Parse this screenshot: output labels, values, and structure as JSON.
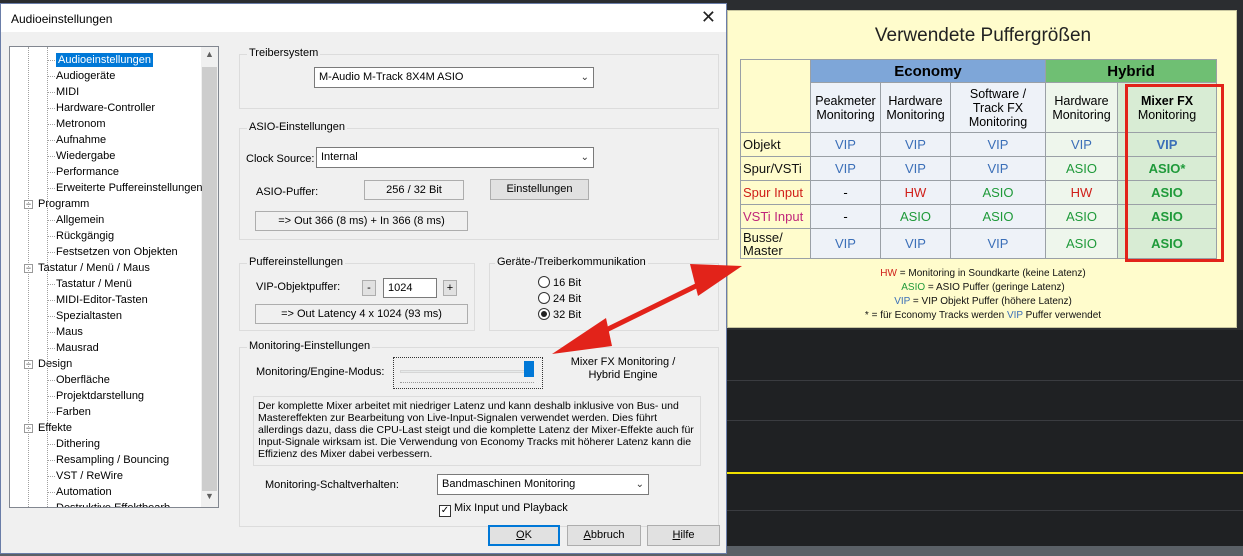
{
  "dialog": {
    "title": "Audioeinstellungen",
    "close_label": "✕"
  },
  "tree": {
    "items": [
      {
        "label": "Audioeinstellungen",
        "selected": true
      },
      {
        "label": "Audiogeräte"
      },
      {
        "label": "MIDI"
      },
      {
        "label": "Hardware-Controller"
      },
      {
        "label": "Metronom"
      },
      {
        "label": "Aufnahme"
      },
      {
        "label": "Wiedergabe"
      },
      {
        "label": "Performance"
      },
      {
        "label": "Erweiterte Puffereinstellungen"
      },
      {
        "label": "Programm",
        "group": true
      },
      {
        "label": "Allgemein"
      },
      {
        "label": "Rückgängig"
      },
      {
        "label": "Festsetzen von Objekten"
      },
      {
        "label": "Tastatur / Menü / Maus",
        "group": true
      },
      {
        "label": "Tastatur / Menü"
      },
      {
        "label": "MIDI-Editor-Tasten"
      },
      {
        "label": "Spezialtasten"
      },
      {
        "label": "Maus"
      },
      {
        "label": "Mausrad"
      },
      {
        "label": "Design",
        "group": true
      },
      {
        "label": "Oberfläche"
      },
      {
        "label": "Projektdarstellung"
      },
      {
        "label": "Farben"
      },
      {
        "label": "Effekte",
        "group": true
      },
      {
        "label": "Dithering"
      },
      {
        "label": "Resampling / Bouncing"
      },
      {
        "label": "VST / ReWire"
      },
      {
        "label": "Automation"
      },
      {
        "label": "Destruktive Effektbearb"
      }
    ]
  },
  "treiber": {
    "group_label": "Treibersystem",
    "value": "M-Audio M-Track 8X4M ASIO"
  },
  "asio": {
    "group_label": "ASIO-Einstellungen",
    "clock_label": "Clock Source:",
    "clock_value": "Internal",
    "puffer_label": "ASIO-Puffer:",
    "puffer_value": "256 / 32 Bit",
    "settings_button": "Einstellungen",
    "latency": "=> Out 366 (8 ms) + In 366 (8 ms)"
  },
  "puffer": {
    "group_label": "Puffereinstellungen",
    "vip_label": "VIP-Objektpuffer:",
    "minus": "-",
    "plus": "+",
    "vip_value": "1024",
    "latency": "=> Out Latency 4 x 1024 (93 ms)"
  },
  "geraete": {
    "group_label": "Geräte-/Treiberkommunikation",
    "options": [
      "16 Bit",
      "24 Bit",
      "32 Bit"
    ],
    "selected": "32 Bit"
  },
  "monitoring": {
    "group_label": "Monitoring-Einstellungen",
    "mode_label": "Monitoring/Engine-Modus:",
    "mode_value_line1": "Mixer FX Monitoring /",
    "mode_value_line2": "Hybrid Engine",
    "slider_level": 1.0,
    "description": "Der komplette Mixer arbeitet mit niedriger Latenz und kann deshalb inklusive von Bus- und Mastereffekten zur Bearbeitung von Live-Input-Signalen verwendet werden. Dies führt allerdings dazu, dass die CPU-Last steigt und die komplette Latenz der Mixer-Effekte auch für Input-Signale wirksam ist. Die Verwendung von Economy Tracks mit höherer Latenz kann die Effizienz des Mixer dabei verbessern.",
    "schalt_label": "Monitoring-Schaltverhalten:",
    "schalt_value": "Bandmaschinen Monitoring",
    "mix_checkbox_label": "Mix Input und Playback",
    "mix_checked": true
  },
  "buttons": {
    "ok": "OK",
    "cancel": "Abbruch",
    "help": "Hilfe"
  },
  "info": {
    "title": "Verwendete Puffergrößen",
    "economy": "Economy",
    "hybrid": "Hybrid",
    "columns": [
      [
        "Peakmeter",
        "Monitoring"
      ],
      [
        "Hardware",
        "Monitoring"
      ],
      [
        "Software /",
        "Track FX",
        "Monitoring"
      ],
      [
        "Hardware",
        "Monitoring"
      ],
      [
        "Mixer FX",
        "Monitoring"
      ]
    ],
    "rows": [
      {
        "label": [
          "Objekt"
        ],
        "label_color": "#111111",
        "cells": [
          "VIP",
          "VIP",
          "VIP",
          "VIP",
          "VIP"
        ]
      },
      {
        "label": [
          "Spur/VSTi"
        ],
        "label_color": "#111111",
        "cells": [
          "VIP",
          "VIP",
          "VIP",
          "ASIO",
          "ASIO*"
        ]
      },
      {
        "label": [
          "Spur Input"
        ],
        "label_color": "#d0201a",
        "cells": [
          "-",
          "HW",
          "ASIO",
          "HW",
          "ASIO"
        ]
      },
      {
        "label": [
          "VSTi Input"
        ],
        "label_color": "#c0267a",
        "cells": [
          "-",
          "ASIO",
          "ASIO",
          "ASIO",
          "ASIO"
        ]
      },
      {
        "label": [
          "Busse/",
          "Master"
        ],
        "label_color": "#111111",
        "cells": [
          "VIP",
          "VIP",
          "VIP",
          "ASIO",
          "ASIO"
        ]
      }
    ],
    "legend": [
      {
        "key": "HW",
        "text": " = Monitoring in Soundkarte (keine Latenz)",
        "color": "#d0201a"
      },
      {
        "key": "ASIO",
        "text": " = ASIO Puffer (geringe Latenz)",
        "color": "#1f9a3a"
      },
      {
        "key": "VIP",
        "text": " = VIP Objekt Puffer (höhere Latenz)",
        "color": "#3b6fb8"
      }
    ],
    "footnote_pre": "* = für Economy Tracks werden ",
    "footnote_key": "VIP",
    "footnote_post": " Puffer verwendet"
  },
  "colors": {
    "economy_header": "#7ea6d8",
    "hybrid_header": "#6fbf73",
    "vip": "#3b6fb8",
    "asio": "#1f9a3a",
    "hw": "#d0201a",
    "arrow": "#e2231a"
  }
}
